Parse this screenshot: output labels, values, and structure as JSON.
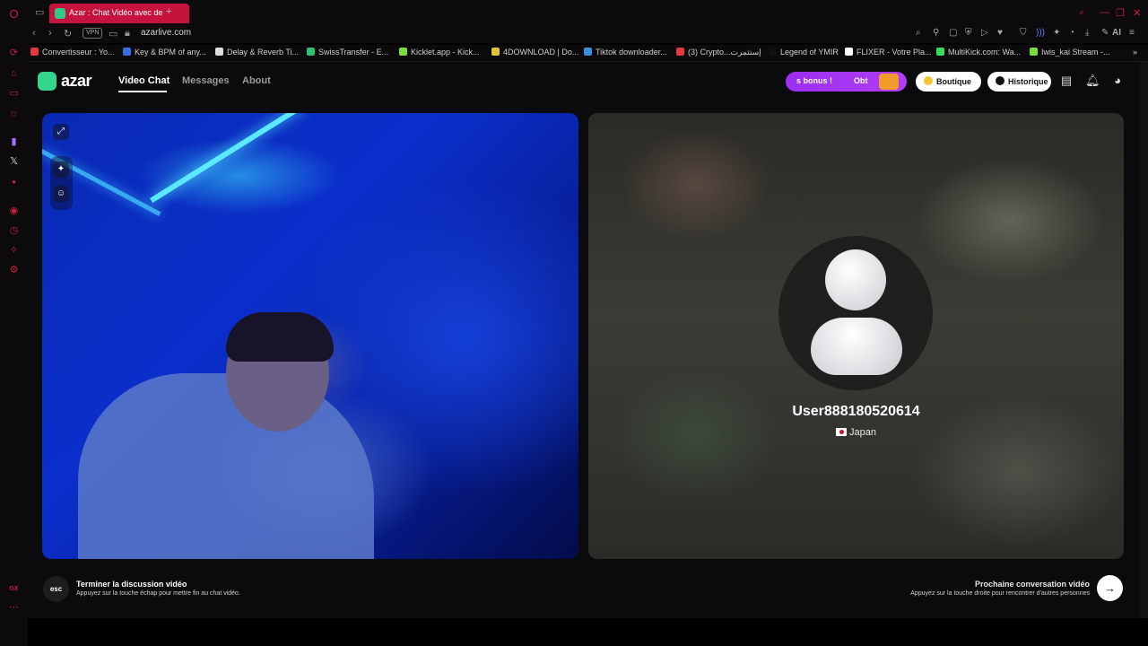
{
  "browser": {
    "tab": {
      "title": "Azar : Chat Vidéo avec de"
    },
    "address": {
      "vpn_label": "VPN",
      "url": "azarlive.com"
    },
    "toolbar": {
      "ai_label": "AI"
    },
    "bookmarks": [
      {
        "label": "Convertisseur : Yo...",
        "color": "#e23b3b"
      },
      {
        "label": "Key & BPM of any...",
        "color": "#3b6ee2"
      },
      {
        "label": "Delay & Reverb Ti...",
        "color": "#dddddd"
      },
      {
        "label": "SwissTransfer - E...",
        "color": "#2fbf71"
      },
      {
        "label": "Kicklet.app - Kick...",
        "color": "#7bdc3b"
      },
      {
        "label": "4DOWNLOAD | Do...",
        "color": "#e2c23b"
      },
      {
        "label": "Tiktok downloader...",
        "color": "#3b8ee2"
      },
      {
        "label": "(3) Crypto...إستثمرت",
        "color": "#e23b3b"
      },
      {
        "label": "Legend of YMIR",
        "color": "#111111"
      },
      {
        "label": "FLIXER - Votre Pla...",
        "color": "#ffffff"
      },
      {
        "label": "MultiKick.com: Wa...",
        "color": "#3bdc5a"
      },
      {
        "label": "Iwis_kai Stream -...",
        "color": "#7bdc3b"
      }
    ],
    "sidebar_footer": "GX"
  },
  "app": {
    "logo_text": "azar",
    "nav": [
      {
        "label": "Video Chat",
        "active": true
      },
      {
        "label": "Messages",
        "active": false
      },
      {
        "label": "About",
        "active": false
      }
    ],
    "promo": {
      "text_a": "s bonus !",
      "text_b": "Obt"
    },
    "boutique_label": "Boutique",
    "historique_label": "Historique"
  },
  "remote_user": {
    "name": "User888180520614",
    "country": "Japan"
  },
  "controls": {
    "esc_label": "esc",
    "end_title": "Terminer la discussion vidéo",
    "end_sub": "Appuyez sur la touche échap pour mettre fin au chat vidéo.",
    "next_title": "Prochaine conversation vidéo",
    "next_sub": "Appuyez sur la touche droite pour rencontrer d'autres personnes",
    "next_icon": "arrow-right-icon"
  },
  "colors": {
    "opera_red": "#c4203f",
    "tab_active": "#c5133e",
    "azar_green": "#34d58c",
    "promo_purple": "#9b2ff0"
  }
}
